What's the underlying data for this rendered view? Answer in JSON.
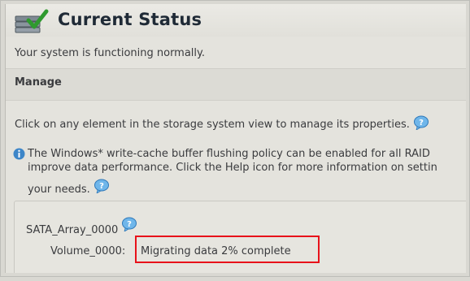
{
  "header": {
    "title": "Current Status",
    "icon": "storage-check-icon"
  },
  "system_message": "Your system is functioning normally.",
  "manage": {
    "title": "Manage",
    "instruction": "Click on any element in the storage system view to manage its properties.",
    "help_icon": "help-icon"
  },
  "info": {
    "icon": "info-icon",
    "lines": [
      "The Windows* write-cache buffer flushing policy can be enabled for all RAID",
      "improve data performance. Click the Help icon for more information on settin",
      "your needs."
    ]
  },
  "array": {
    "name": "SATA_Array_0000",
    "volume_label": "Volume_0000:",
    "volume_status": "Migrating data 2% complete",
    "progress_percent": 2
  },
  "colors": {
    "highlight": "#e8121a",
    "help_icon": "#3a8fd0"
  }
}
